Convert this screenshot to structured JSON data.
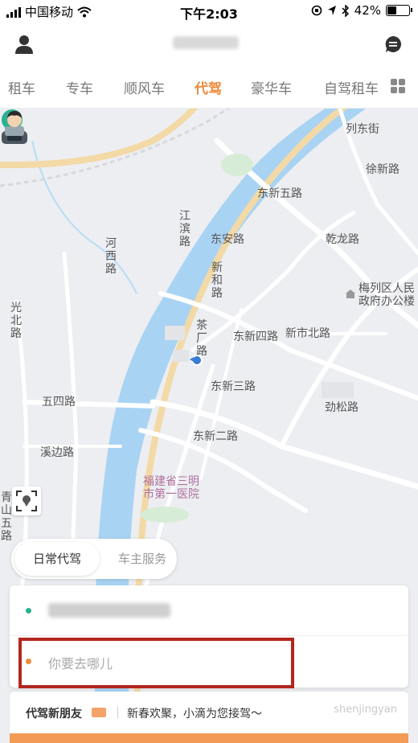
{
  "status_bar": {
    "carrier": "中国移动",
    "time": "下午2:03",
    "battery_text": "42%"
  },
  "nav_tabs": [
    {
      "label": "租车"
    },
    {
      "label": "专车"
    },
    {
      "label": "顺风车"
    },
    {
      "label": "代驾",
      "active": true
    },
    {
      "label": "豪华车"
    },
    {
      "label": "自驾租车"
    }
  ],
  "map": {
    "labels": {
      "lie_dong": "列东街",
      "xu_xin": "徐新路",
      "dong_xin_5": "东新五路",
      "jiang_bin": "江滨路",
      "dong_an": "东安路",
      "he_xi": "河西路",
      "xin_he": "新和路",
      "qian_long": "乾龙路",
      "gov1": "梅列区人民",
      "gov2": "政府办公楼",
      "bei": "北路",
      "cha_chang": "茶厂路",
      "dong_xin_4": "东新四路",
      "xin_shi_bei": "新市北路",
      "dong_xin_3": "东新三路",
      "wu_si": "五四路",
      "jin_song": "劲松路",
      "dong_xin_2": "东新二路",
      "xi_bian": "溪边路",
      "hosp1": "福建省三明",
      "hosp2": "市第一医院",
      "qing_shan": "青山五路",
      "left_edge": "光北路"
    }
  },
  "service_toggle": {
    "active": "日常代驾",
    "inactive": "车主服务"
  },
  "address_card": {
    "destination_placeholder": "你要去哪儿"
  },
  "promo": {
    "title": "代驾新朋友",
    "desc": "新春欢聚，小滴为您接驾～",
    "watermark": "shenjingyan"
  },
  "colors": {
    "accent": "#f08a3c",
    "river": "#a9d3f3",
    "major_road": "#f3d9a6",
    "pin": "#2bb191",
    "highlight_box": "#b3261e"
  }
}
